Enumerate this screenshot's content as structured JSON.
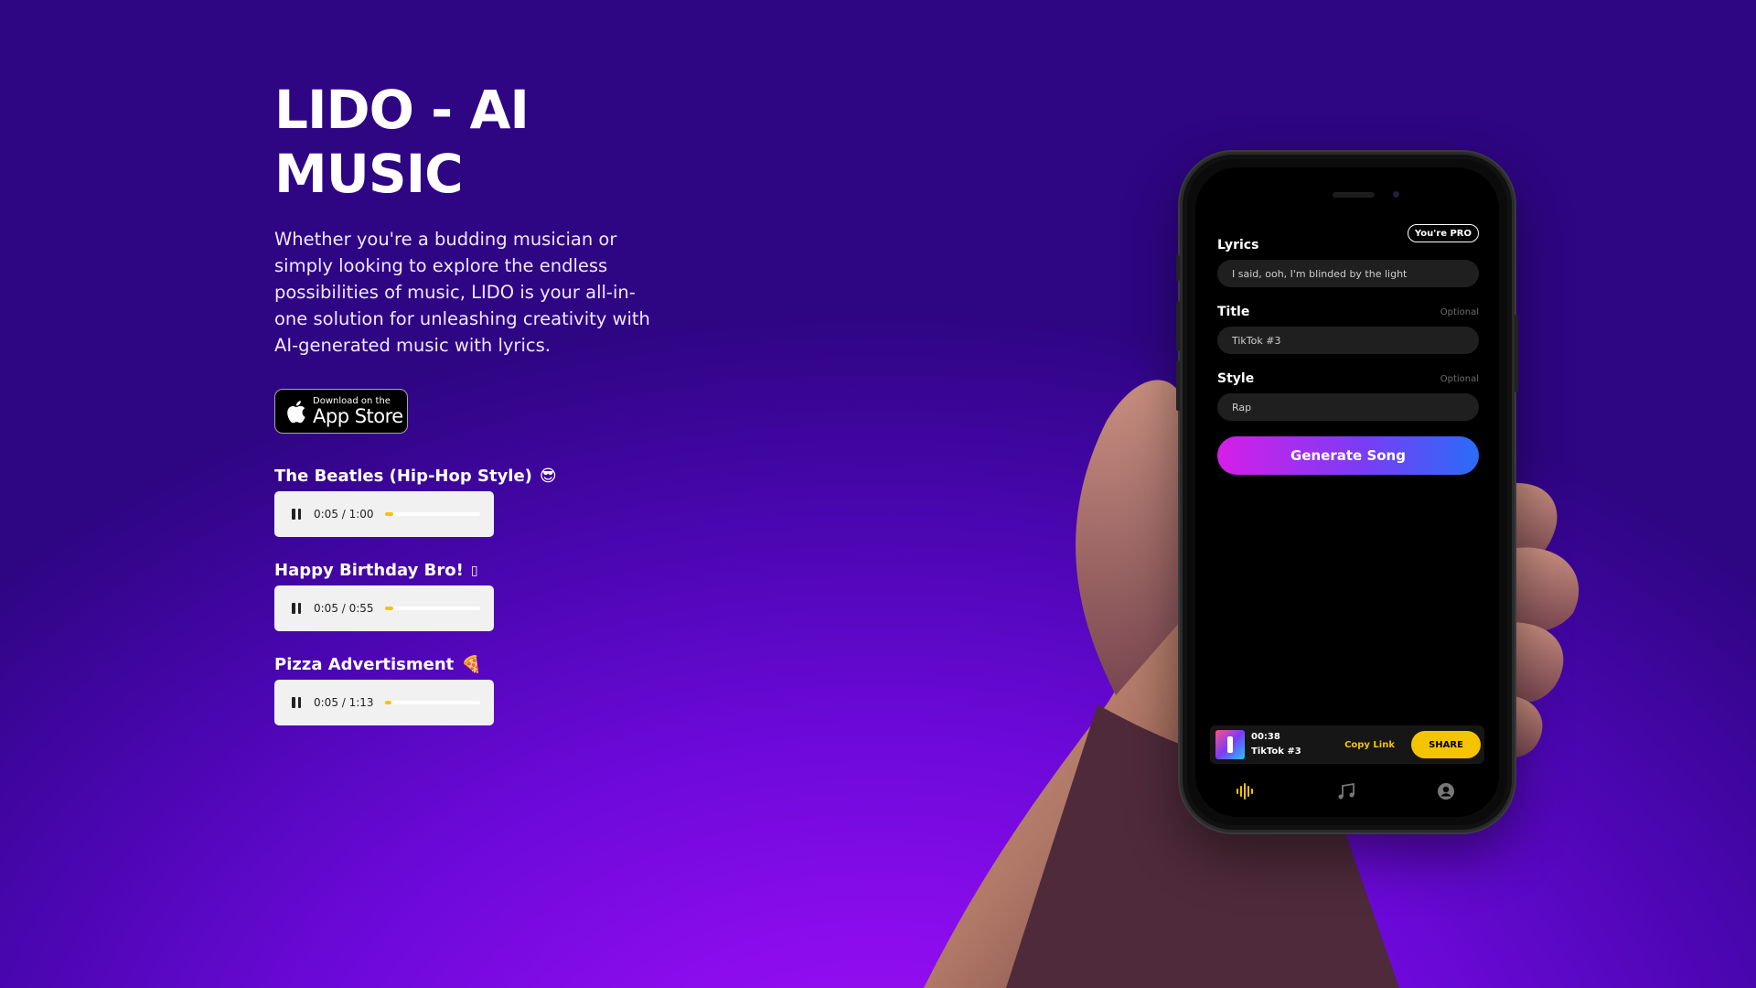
{
  "hero": {
    "title": "LIDO - AI MUSIC",
    "description": "Whether you're a budding musician or simply looking to explore the endless possibilities of music, LIDO is your all-in-one solution for unleashing creativity with AI-generated music with lyrics."
  },
  "app_store": {
    "line1": "Download on the",
    "line2": "App Store"
  },
  "tracks": [
    {
      "title": "The Beatles (Hip-Hop Style)",
      "emoji": "😎",
      "time": "0:05 / 1:00",
      "progress": 0.083
    },
    {
      "title": "Happy Birthday Bro!",
      "emoji": "▯",
      "time": "0:05 / 0:55",
      "progress": 0.091
    },
    {
      "title": "Pizza Advertisment",
      "emoji": "🍕",
      "time": "0:05 / 1:13",
      "progress": 0.068
    }
  ],
  "phone": {
    "pro_badge": "You're PRO",
    "lyrics_label": "Lyrics",
    "lyrics_value": "I said, ooh, I'm blinded by the light",
    "title_label": "Title",
    "title_optional": "Optional",
    "title_value": "TikTok #3",
    "style_label": "Style",
    "style_optional": "Optional",
    "style_value": "Rap",
    "generate_button": "Generate Song",
    "mini_player": {
      "duration": "00:38",
      "track": "TikTok #3",
      "copy_link": "Copy Link",
      "share": "SHARE"
    },
    "tabs": [
      "waveform-icon",
      "music-notes-icon",
      "profile-icon"
    ]
  },
  "colors": {
    "accent_yellow": "#f5c400",
    "background_top": "#2e0583",
    "background_bottom": "#a10ff6",
    "gradient_button_start": "#d61ee8",
    "gradient_button_end": "#2a6cf7"
  }
}
